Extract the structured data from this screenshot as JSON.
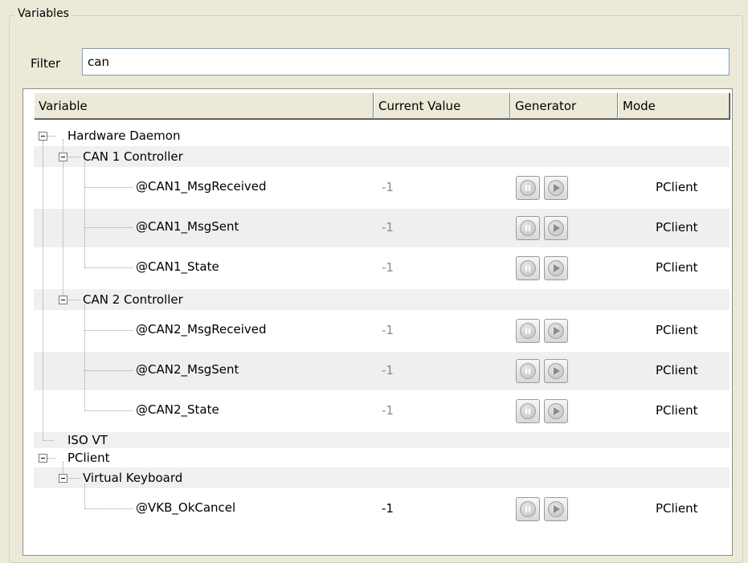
{
  "group": {
    "caption": "Variables"
  },
  "filter": {
    "label": "Filter",
    "value": "can"
  },
  "columns": {
    "variable": "Variable",
    "current_value": "Current Value",
    "generator": "Generator",
    "mode": "Mode"
  },
  "tree": {
    "hardware_daemon": "Hardware Daemon",
    "can1": {
      "label": "CAN 1 Controller",
      "vars": [
        {
          "name": "@CAN1_MsgReceived",
          "value": "-1",
          "mode": "PClient"
        },
        {
          "name": "@CAN1_MsgSent",
          "value": "-1",
          "mode": "PClient"
        },
        {
          "name": "@CAN1_State",
          "value": "-1",
          "mode": "PClient"
        }
      ]
    },
    "can2": {
      "label": "CAN 2 Controller",
      "vars": [
        {
          "name": "@CAN2_MsgReceived",
          "value": "-1",
          "mode": "PClient"
        },
        {
          "name": "@CAN2_MsgSent",
          "value": "-1",
          "mode": "PClient"
        },
        {
          "name": "@CAN2_State",
          "value": "-1",
          "mode": "PClient"
        }
      ]
    },
    "iso_vt": "ISO VT",
    "pclient": "PClient",
    "virtual_keyboard": {
      "label": "Virtual Keyboard",
      "vars": [
        {
          "name": "@VKB_OkCancel",
          "value": "-1",
          "mode": "PClient"
        }
      ]
    }
  },
  "icons": {
    "expand": "minus-box-icon",
    "pause": "pause-icon",
    "play": "play-icon"
  }
}
